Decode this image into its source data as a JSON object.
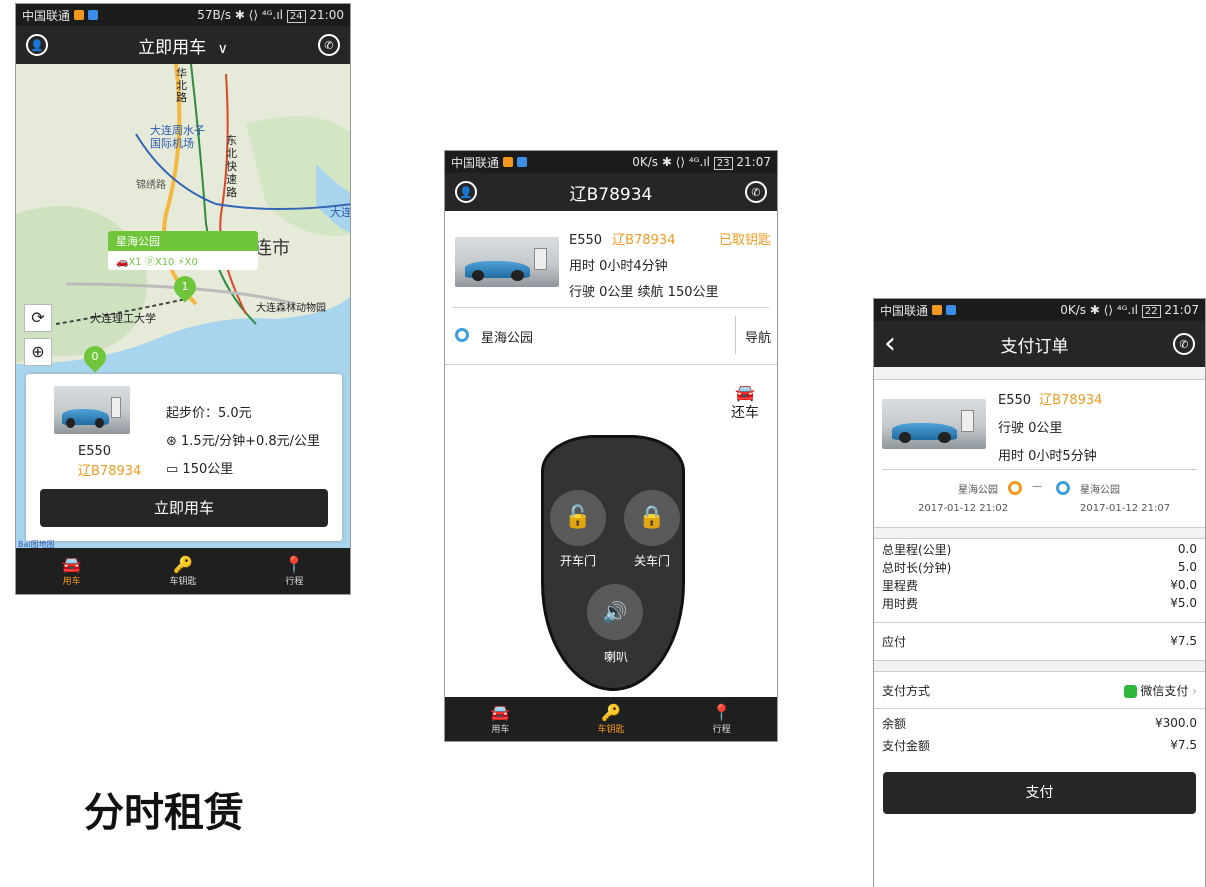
{
  "caption": "分时租赁",
  "phone1": {
    "status": {
      "carrier": "中国联通",
      "right": "57B/s ✱ ⟨⟩ ⁴ᴳ.ıl",
      "battery": "24",
      "time": "21:00"
    },
    "title": "立即用车",
    "title_chevron": "∨",
    "map": {
      "station_name": "星海公园",
      "station_counts": "🚗X1 ⓟX10 ⚡X0",
      "labels": {
        "airport": "大连周水子国际机场",
        "road_n": "华北路",
        "road_e": "东北快速路",
        "jinxiu": "锦绣路",
        "city": "连市",
        "univ": "大连理工大学",
        "zoo": "大连森林动物园",
        "dalian_edge": "大连",
        "baidu": "Bai图地图"
      },
      "marker1": "1",
      "marker2": "0"
    },
    "card": {
      "start_price": "起步价：5.0元",
      "rate": "1.5元/分钟+0.8元/公里",
      "range": "150公里",
      "model": "E550",
      "plate": "辽B78934",
      "button": "立即用车"
    },
    "tabs": [
      {
        "label": "用车"
      },
      {
        "label": "车钥匙"
      },
      {
        "label": "行程"
      }
    ]
  },
  "phone2": {
    "status": {
      "carrier": "中国联通",
      "right": "0K/s ✱ ⟨⟩ ⁴ᴳ.ıl",
      "battery": "23",
      "time": "21:07"
    },
    "title": "辽B78934",
    "car": {
      "model": "E550",
      "plate": "辽B78934",
      "key_status": "已取钥匙",
      "time_used": "用时 0小时4分钟",
      "distance": "行驶 0公里  续航 150公里"
    },
    "location": "星海公园",
    "nav": "导航",
    "return": "还车",
    "controls": {
      "open": "开车门",
      "close": "关车门",
      "horn": "喇叭"
    },
    "tabs": [
      {
        "label": "用车"
      },
      {
        "label": "车钥匙"
      },
      {
        "label": "行程"
      }
    ]
  },
  "phone3": {
    "status": {
      "carrier": "中国联通",
      "right": "0K/s ✱ ⟨⟩ ⁴ᴳ.ıl",
      "battery": "22",
      "time": "21:07"
    },
    "back": "‹",
    "title": "支付订单",
    "car": {
      "model": "E550",
      "plate": "辽B78934",
      "distance": "行驶 0公里",
      "time_used": "用时 0小时5分钟"
    },
    "trip": {
      "from": "星海公园",
      "from_time": "2017-01-12 21:02",
      "dash": "—",
      "to": "星海公园",
      "to_time": "2017-01-12 21:07"
    },
    "fees": [
      {
        "label": "总里程(公里)",
        "value": "0.0"
      },
      {
        "label": "总时长(分钟)",
        "value": "5.0"
      },
      {
        "label": "里程费",
        "value": "¥0.0"
      },
      {
        "label": "用时费",
        "value": "¥5.0"
      }
    ],
    "due": {
      "label": "应付",
      "value": "¥7.5"
    },
    "pay_method": {
      "label": "支付方式",
      "value": "微信支付"
    },
    "balance": {
      "label": "余额",
      "value": "¥300.0"
    },
    "pay_amount": {
      "label": "支付金额",
      "value": "¥7.5"
    },
    "button": "支付"
  },
  "colors": {
    "accent": "#f39a1e",
    "dark": "#262626",
    "green": "#6fc63a",
    "blue": "#3aa0e0",
    "wechat": "#2db83d"
  }
}
